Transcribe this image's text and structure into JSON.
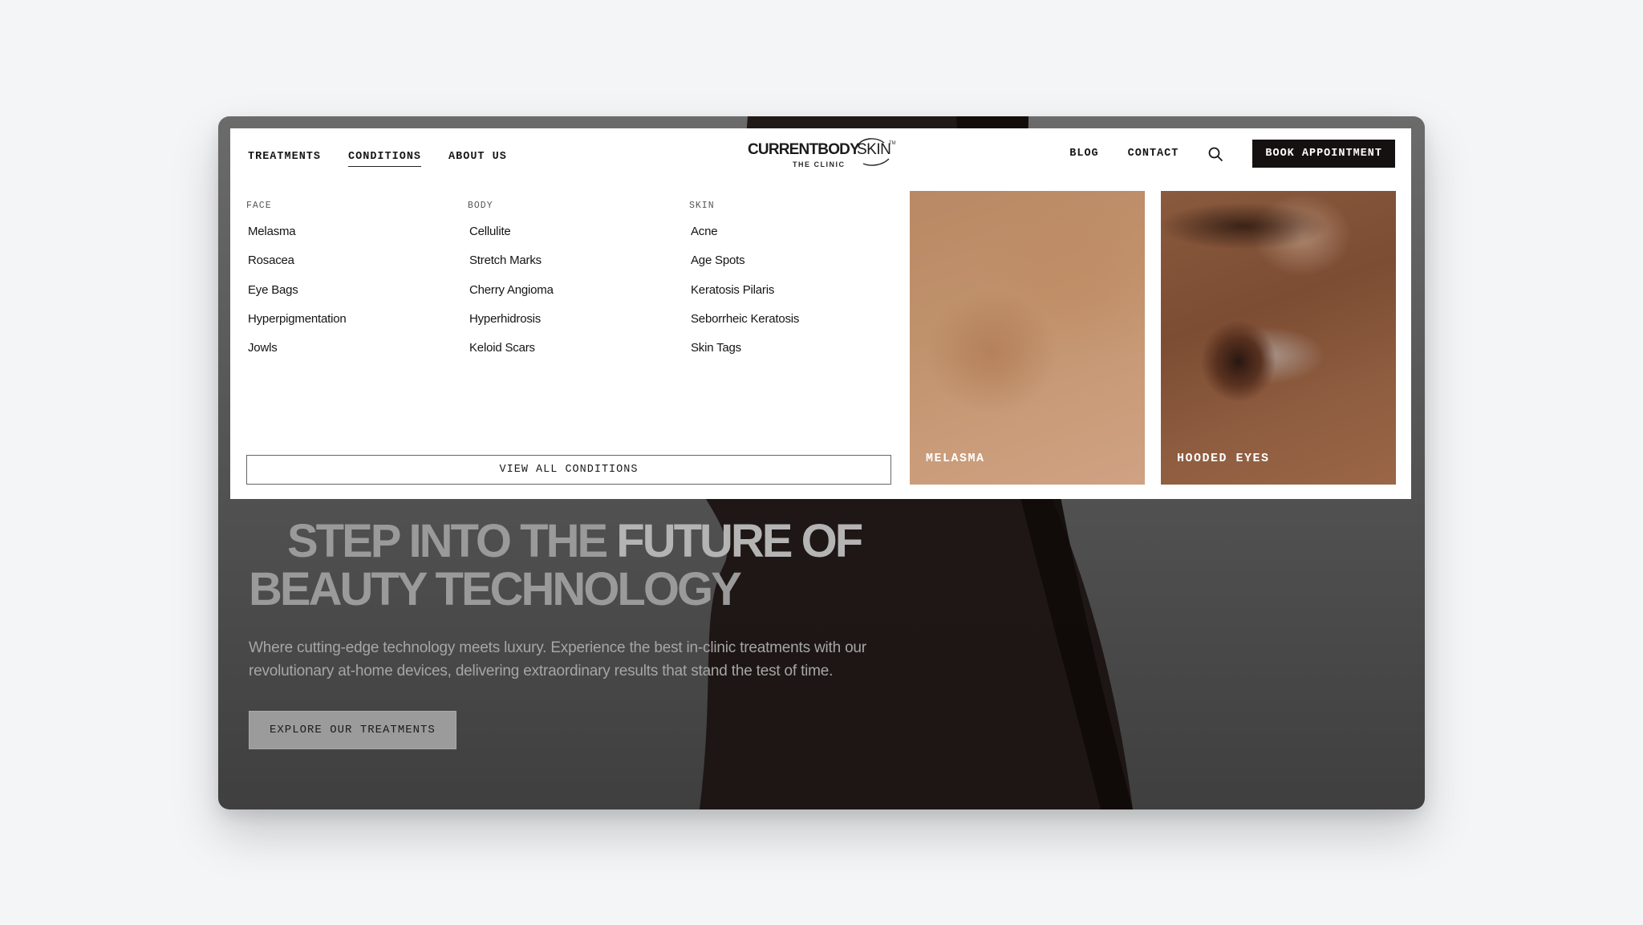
{
  "nav": {
    "left_links": [
      {
        "label": "TREATMENTS",
        "active": false
      },
      {
        "label": "CONDITIONS",
        "active": true
      },
      {
        "label": "ABOUT US",
        "active": false
      }
    ],
    "logo": {
      "brand_bold": "CURRENTBODY",
      "brand_light": "SKIN",
      "trademark": "TM",
      "subtitle": "THE CLINIC"
    },
    "right_links": [
      {
        "label": "BLOG"
      },
      {
        "label": "CONTACT"
      }
    ],
    "search_icon": "search-icon",
    "book_button": "BOOK APPOINTMENT"
  },
  "mega_menu": {
    "columns": [
      {
        "heading": "FACE",
        "items": [
          "Melasma",
          "Rosacea",
          "Eye Bags",
          "Hyperpigmentation",
          "Jowls"
        ]
      },
      {
        "heading": "BODY",
        "items": [
          "Cellulite",
          "Stretch Marks",
          "Cherry Angioma",
          "Hyperhidrosis",
          "Keloid Scars"
        ]
      },
      {
        "heading": "SKIN",
        "items": [
          "Acne",
          "Age Spots",
          "Keratosis Pilaris",
          "Seborrheic Keratosis",
          "Skin Tags"
        ]
      }
    ],
    "view_all_button": "VIEW ALL CONDITIONS",
    "featured_cards": [
      {
        "label": "MELASMA",
        "image": "close-up skin with melasma patches"
      },
      {
        "label": "HOODED EYES",
        "image": "close-up of an eye"
      }
    ]
  },
  "hero": {
    "title_line1_a": "STEP INTO THE ",
    "title_line1_b": "FUTURE OF",
    "title_line2": "BEAUTY TECHNOLOGY",
    "description": "Where cutting-edge technology meets luxury. Experience the best in-clinic treatments with our revolutionary at-home devices, delivering extraordinary results that stand the test of time.",
    "cta_button": "EXPLORE OUR TREATMENTS"
  },
  "colors": {
    "book_button_bg": "#161111",
    "panel_bg": "#ffffff",
    "hero_overlay": "#555555",
    "hero_text": "#9a9a9a"
  }
}
